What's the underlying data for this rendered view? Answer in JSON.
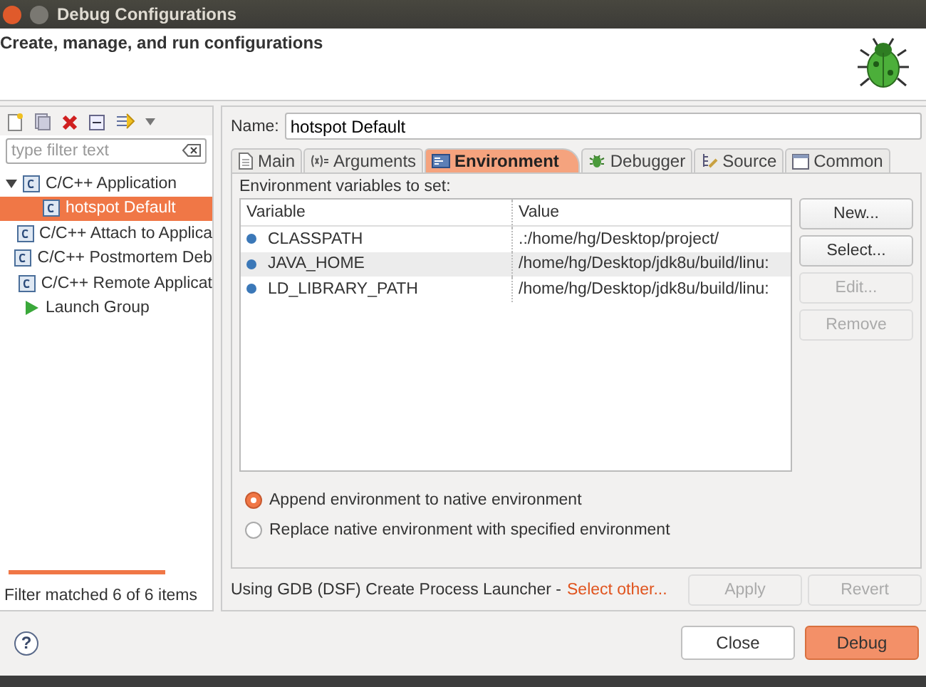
{
  "window": {
    "title": "Debug Configurations"
  },
  "header": {
    "message": "Create, manage, and run configurations"
  },
  "sidebar": {
    "filter": {
      "placeholder": "type filter text"
    },
    "tree": [
      {
        "label": "C/C++ Application",
        "kind": "config",
        "expanded": true,
        "selected": false,
        "children": [
          {
            "label": "hotspot Default",
            "kind": "config",
            "selected": true
          }
        ]
      },
      {
        "label": "C/C++ Attach to Applica",
        "kind": "config",
        "selected": false
      },
      {
        "label": "C/C++ Postmortem Deb",
        "kind": "config",
        "selected": false
      },
      {
        "label": "C/C++ Remote Applicat",
        "kind": "config",
        "selected": false
      },
      {
        "label": "Launch Group",
        "kind": "group",
        "selected": false
      }
    ],
    "status": "Filter matched 6 of 6 items"
  },
  "name_field": {
    "label": "Name:",
    "value": "hotspot Default"
  },
  "tabs": [
    {
      "label": "Main",
      "selected": false
    },
    {
      "label": "Arguments",
      "selected": false
    },
    {
      "label": "Environment",
      "selected": true
    },
    {
      "label": "Debugger",
      "selected": false
    },
    {
      "label": "Source",
      "selected": false
    },
    {
      "label": "Common",
      "selected": false
    }
  ],
  "environment": {
    "caption": "Environment variables to set:",
    "columns": [
      "Variable",
      "Value"
    ],
    "rows": [
      {
        "variable": "CLASSPATH",
        "value": ".:/home/hg/Desktop/project/",
        "selected": false
      },
      {
        "variable": "JAVA_HOME",
        "value": "/home/hg/Desktop/jdk8u/build/linu:",
        "selected": true
      },
      {
        "variable": "LD_LIBRARY_PATH",
        "value": "/home/hg/Desktop/jdk8u/build/linu:",
        "selected": false
      }
    ],
    "buttons": [
      {
        "label": "New...",
        "disabled": false
      },
      {
        "label": "Select...",
        "disabled": false
      },
      {
        "label": "Edit...",
        "disabled": true
      },
      {
        "label": "Remove",
        "disabled": true
      }
    ],
    "options": [
      {
        "label": "Append environment to native environment",
        "selected": true
      },
      {
        "label": "Replace native environment with specified environment",
        "selected": false
      }
    ]
  },
  "launcher": {
    "text": "Using GDB (DSF) Create Process Launcher -",
    "link": "Select other..."
  },
  "apply_buttons": [
    {
      "label": "Apply",
      "disabled": true
    },
    {
      "label": "Revert",
      "disabled": true
    }
  ],
  "help_button": {
    "label": "?"
  },
  "dialog_buttons": [
    {
      "label": "Close",
      "primary": false
    },
    {
      "label": "Debug",
      "primary": true
    }
  ]
}
